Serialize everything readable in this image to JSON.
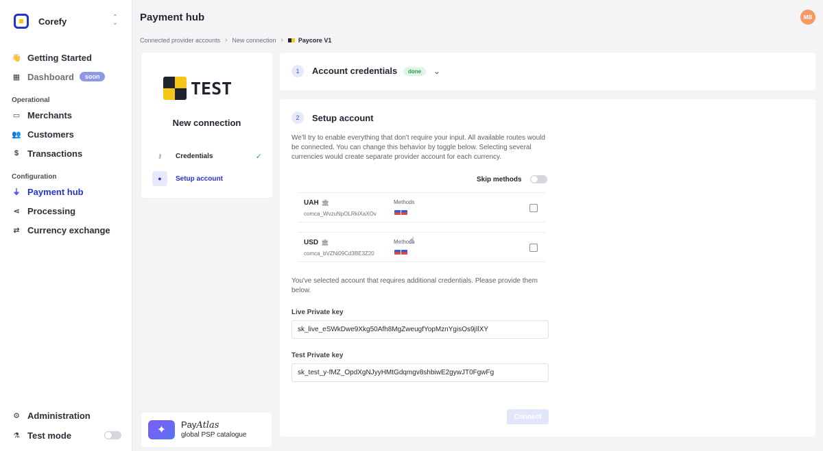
{
  "sidebar": {
    "brand": "Corefy",
    "items": [
      {
        "label": "Getting Started",
        "icon": "wave-hand-icon"
      },
      {
        "label": "Dashboard",
        "badge": "soon",
        "icon": "dashboard-icon"
      },
      {
        "label": "Merchants",
        "icon": "store-icon"
      },
      {
        "label": "Customers",
        "icon": "users-icon"
      },
      {
        "label": "Transactions",
        "icon": "dollar-icon"
      },
      {
        "label": "Payment hub",
        "icon": "plug-icon",
        "active": true
      },
      {
        "label": "Processing",
        "icon": "route-icon"
      },
      {
        "label": "Currency exchange",
        "icon": "exchange-icon"
      },
      {
        "label": "Administration",
        "icon": "gear-icon"
      },
      {
        "label": "Test mode",
        "icon": "flask-icon"
      }
    ],
    "sections": {
      "operational": "Operational",
      "configuration": "Configuration"
    }
  },
  "header": {
    "title": "Payment hub",
    "avatar": "MB",
    "breadcrumb": [
      "Connected provider accounts",
      "New connection",
      "Paycore V1"
    ]
  },
  "left_panel": {
    "logo_text": "TEST",
    "title": "New connection",
    "steps": [
      {
        "label": "Credentials",
        "done": true
      },
      {
        "label": "Setup account",
        "active": true
      }
    ]
  },
  "catalogue": {
    "name": "Pay",
    "name_italic": "Atlas",
    "subtitle": "global PSP catalogue"
  },
  "step1": {
    "number": "1",
    "title": "Account credentials",
    "badge": "done"
  },
  "step2": {
    "number": "2",
    "title": "Setup account",
    "description": "We'll try to enable everything that don't require your input. All available routes would be connected. You can change this behavior by toggle below. Selecting several currencies would create separate provider account for each currency.",
    "skip_label": "Skip methods",
    "accounts": [
      {
        "currency": "UAH",
        "id": "comca_WvzuNpOLRkiXaXOv",
        "methods_label": "Methods"
      },
      {
        "currency": "USD",
        "id": "comca_bVZNi09Cd3BE3Z20",
        "methods_label": "Methods"
      }
    ],
    "note": "You've selected account that requires additional credentials. Please provide them below.",
    "live_label": "Live Private key",
    "live_value": "sk_live_eSWkDwe9Xkg50Afh8MgZweugfYopMznYgisOs9jIlXY",
    "test_label": "Test Private key",
    "test_value": "sk_test_y-fMZ_OpdXgNJyyHMtGdqmgv8shbiwE2gywJT0FgwFg",
    "connect_label": "Connect"
  },
  "colors": {
    "accent": "#2432d8",
    "success": "#2aa45a",
    "avatar": "#f59a64"
  }
}
